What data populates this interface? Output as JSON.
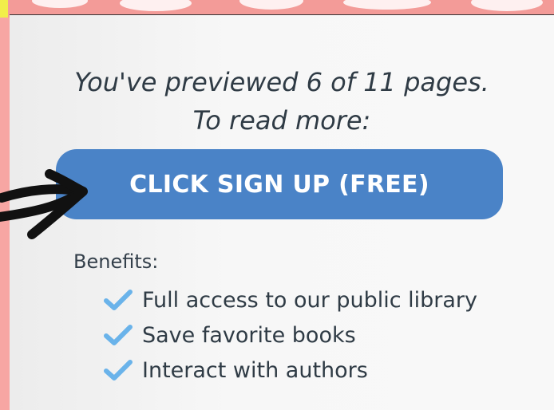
{
  "preview": {
    "line1": "You've previewed 6 of 11 pages.",
    "line2": "To read more:"
  },
  "cta": {
    "label": "CLICK SIGN UP (FREE)"
  },
  "benefits": {
    "title": "Benefits:",
    "items": [
      {
        "label": "Full access to our public library",
        "icon": "checkmark-icon"
      },
      {
        "label": "Save favorite books",
        "icon": "checkmark-icon"
      },
      {
        "label": "Interact with authors",
        "icon": "checkmark-icon"
      }
    ]
  },
  "colors": {
    "accent": "#4a83c7",
    "check": "#6ab3ea",
    "background": "#f7a6a3",
    "card": "#f5f5f5",
    "text": "#2f3b45"
  }
}
